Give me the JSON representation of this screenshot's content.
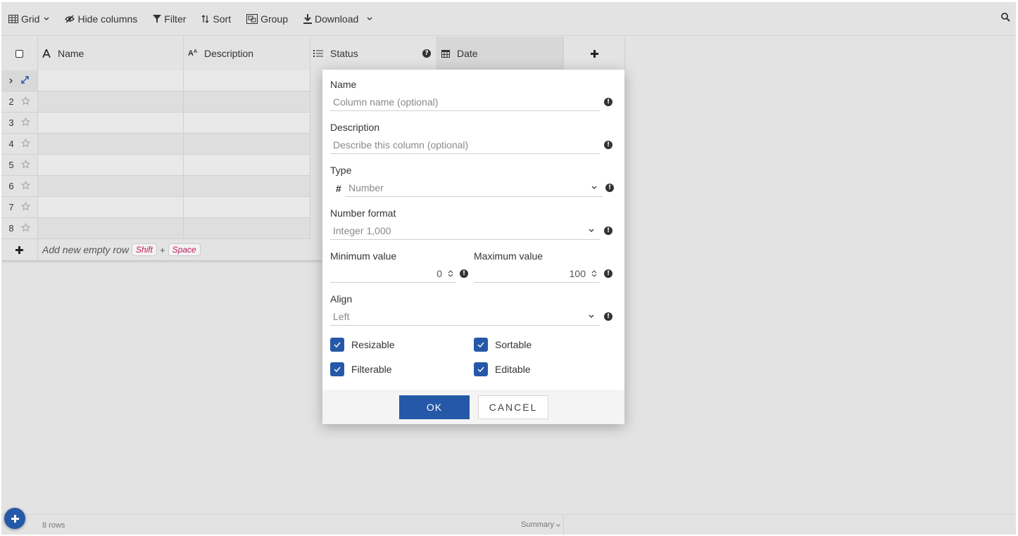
{
  "toolbar": {
    "grid_label": "Grid",
    "hide_columns_label": "Hide columns",
    "filter_label": "Filter",
    "sort_label": "Sort",
    "group_label": "Group",
    "download_label": "Download"
  },
  "columns": [
    {
      "label": "Name",
      "icon": "text-type-icon"
    },
    {
      "label": "Description",
      "icon": "small-text-icon"
    },
    {
      "label": "Status",
      "icon": "list-icon"
    },
    {
      "label": "Date",
      "icon": "calendar-icon"
    }
  ],
  "rows": [
    "",
    "2",
    "3",
    "4",
    "5",
    "6",
    "7",
    "8"
  ],
  "add_row": {
    "label": "Add new empty row",
    "key1": "Shift",
    "plus": "+",
    "key2": "Space"
  },
  "footer": {
    "rows_count": "8 rows",
    "summary_label": "Summary"
  },
  "dialog": {
    "name_label": "Name",
    "name_placeholder": "Column name (optional)",
    "description_label": "Description",
    "description_placeholder": "Describe this column (optional)",
    "type_label": "Type",
    "type_symbol": "#",
    "type_value": "Number",
    "number_format_label": "Number format",
    "number_format_value": "Integer 1,000",
    "min_label": "Minimum value",
    "min_value": "0",
    "max_label": "Maximum value",
    "max_value": "100",
    "align_label": "Align",
    "align_value": "Left",
    "checkboxes": {
      "resizable": "Resizable",
      "sortable": "Sortable",
      "filterable": "Filterable",
      "editable": "Editable"
    },
    "ok_label": "OK",
    "cancel_label": "CANCEL"
  },
  "colors": {
    "accent": "#2559a8",
    "key_text": "#c2185b",
    "background": "#e3e3e3"
  }
}
